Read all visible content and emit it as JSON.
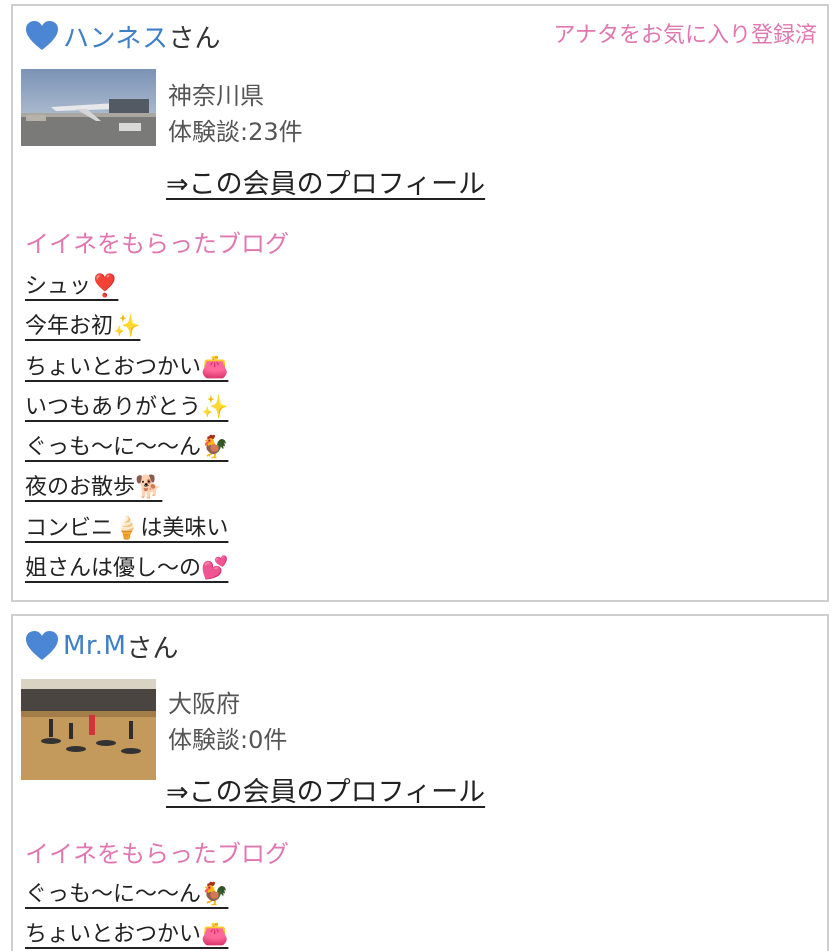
{
  "members": [
    {
      "name": "ハンネス",
      "honorific": "さん",
      "favorite_status": "アナタをお気に入り登録済",
      "prefecture": "神奈川県",
      "count_label": "体験談:23件",
      "profile_link": "⇒この会員のプロフィール",
      "section_title": "イイネをもらったブログ",
      "avatar_icon": "airplane-photo",
      "blogs": [
        "シュッ❣️",
        "今年お初✨",
        "ちょいとおつかい👛",
        "いつもありがとう✨",
        "ぐっも〜に〜〜ん🐓",
        "夜のお散歩🐕",
        "コンビニ🍦は美味い",
        "姐さんは優し〜の💕"
      ]
    },
    {
      "name": "Mr.M",
      "honorific": "さん",
      "prefecture": "大阪府",
      "count_label": "体験談:0件",
      "profile_link": "⇒この会員のプロフィール",
      "section_title": "イイネをもらったブログ",
      "avatar_icon": "gym-photo",
      "blogs": [
        "ぐっも〜に〜〜ん🐓",
        "ちょいとおつかい👛"
      ]
    }
  ],
  "colors": {
    "name": "#3f7fc6",
    "accent": "#e177b0",
    "heart": "#4a86d4"
  }
}
